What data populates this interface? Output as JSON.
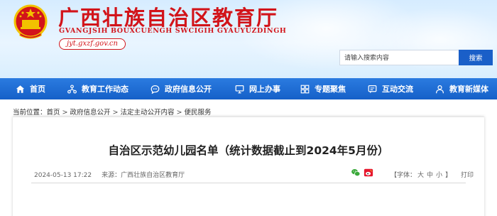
{
  "header": {
    "site_title": "广西壮族自治区教育厅",
    "site_pinyin": "GVANGJSIH BOUXCUENGH SWCIGIH GYAUYUZDINGH",
    "domain": "jyt.gxzf.gov.cn",
    "emblem_icon": "national-emblem",
    "title_color": "#d2141a"
  },
  "search": {
    "placeholder": "请输入搜索内容",
    "button_label": "搜索",
    "button_color": "#1a5fc8"
  },
  "nav": {
    "bar_color": "#1a6ad6",
    "items": [
      {
        "label": "首页",
        "icon": "home-icon"
      },
      {
        "label": "教育工作动态",
        "icon": "network-icon"
      },
      {
        "label": "政府信息公开",
        "icon": "chat-icon"
      },
      {
        "label": "网上办事",
        "icon": "monitor-icon"
      },
      {
        "label": "专题聚焦",
        "icon": "grid-icon"
      },
      {
        "label": "互动交流",
        "icon": "message-icon"
      },
      {
        "label": "教育新媒体",
        "icon": "person-icon"
      }
    ]
  },
  "breadcrumb": {
    "prefix": "当前位置：",
    "items": [
      "首页",
      "政府信息公开",
      "法定主动公开内容",
      "便民服务"
    ],
    "separator": ">"
  },
  "article": {
    "title": "自治区示范幼儿园名单（统计数据截止到2024年5月份）",
    "date": "2024-05-13 17:22",
    "source": "来源：广西壮族自治区教育厅",
    "font_size_label": "【字体：",
    "font_sizes": [
      "大",
      "中",
      "小"
    ],
    "font_size_close": "】",
    "print_label": "打印",
    "share_icons": [
      "wechat-icon",
      "weibo-icon"
    ]
  }
}
